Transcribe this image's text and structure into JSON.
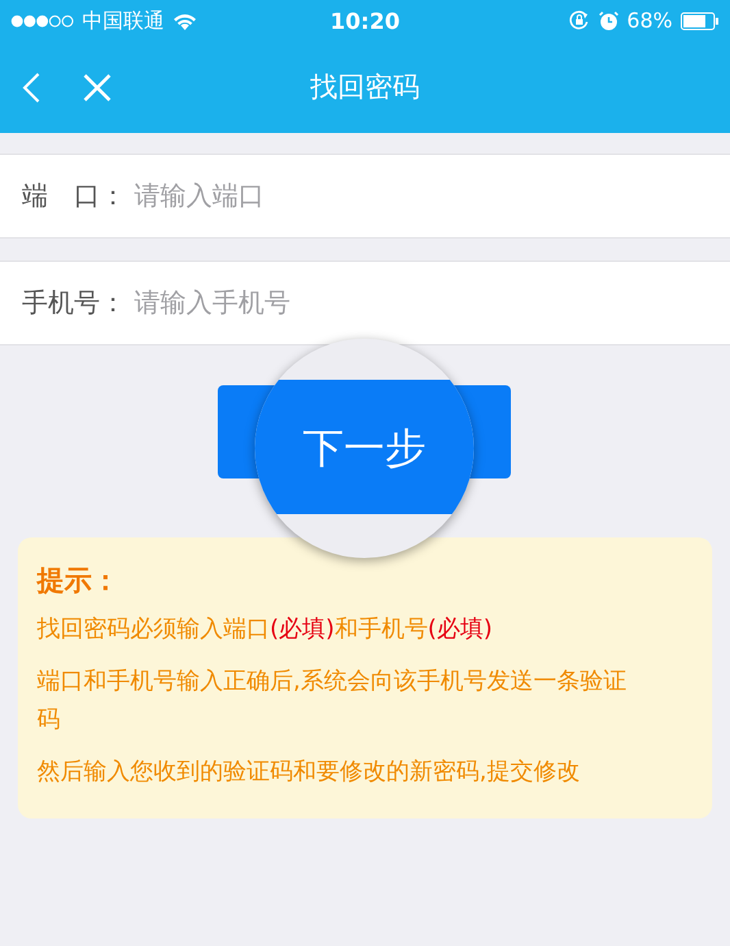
{
  "status_bar": {
    "carrier": "中国联通",
    "time": "10:20",
    "battery": "68%"
  },
  "nav_bar": {
    "title": "找回密码"
  },
  "fields": [
    {
      "label": "端　口：",
      "placeholder": "请输入端口"
    },
    {
      "label": "手机号：",
      "placeholder": "请输入手机号"
    }
  ],
  "next_button": {
    "label": "下一步"
  },
  "tips": {
    "title": "提示：",
    "paragraphs": [
      [
        {
          "text": "找回密码必须输入端口",
          "highlight": false
        },
        {
          "text": "(必填)",
          "highlight": true
        },
        {
          "text": "和手机号",
          "highlight": false
        },
        {
          "text": "(必填)",
          "highlight": true
        }
      ],
      [
        {
          "text": "端口和手机号输入正确后,系统会向该手机号发送一条验证码",
          "highlight": false
        }
      ],
      [
        {
          "text": "然后输入您收到的验证码和要修改的新密码,提交修改",
          "highlight": false
        }
      ]
    ]
  }
}
